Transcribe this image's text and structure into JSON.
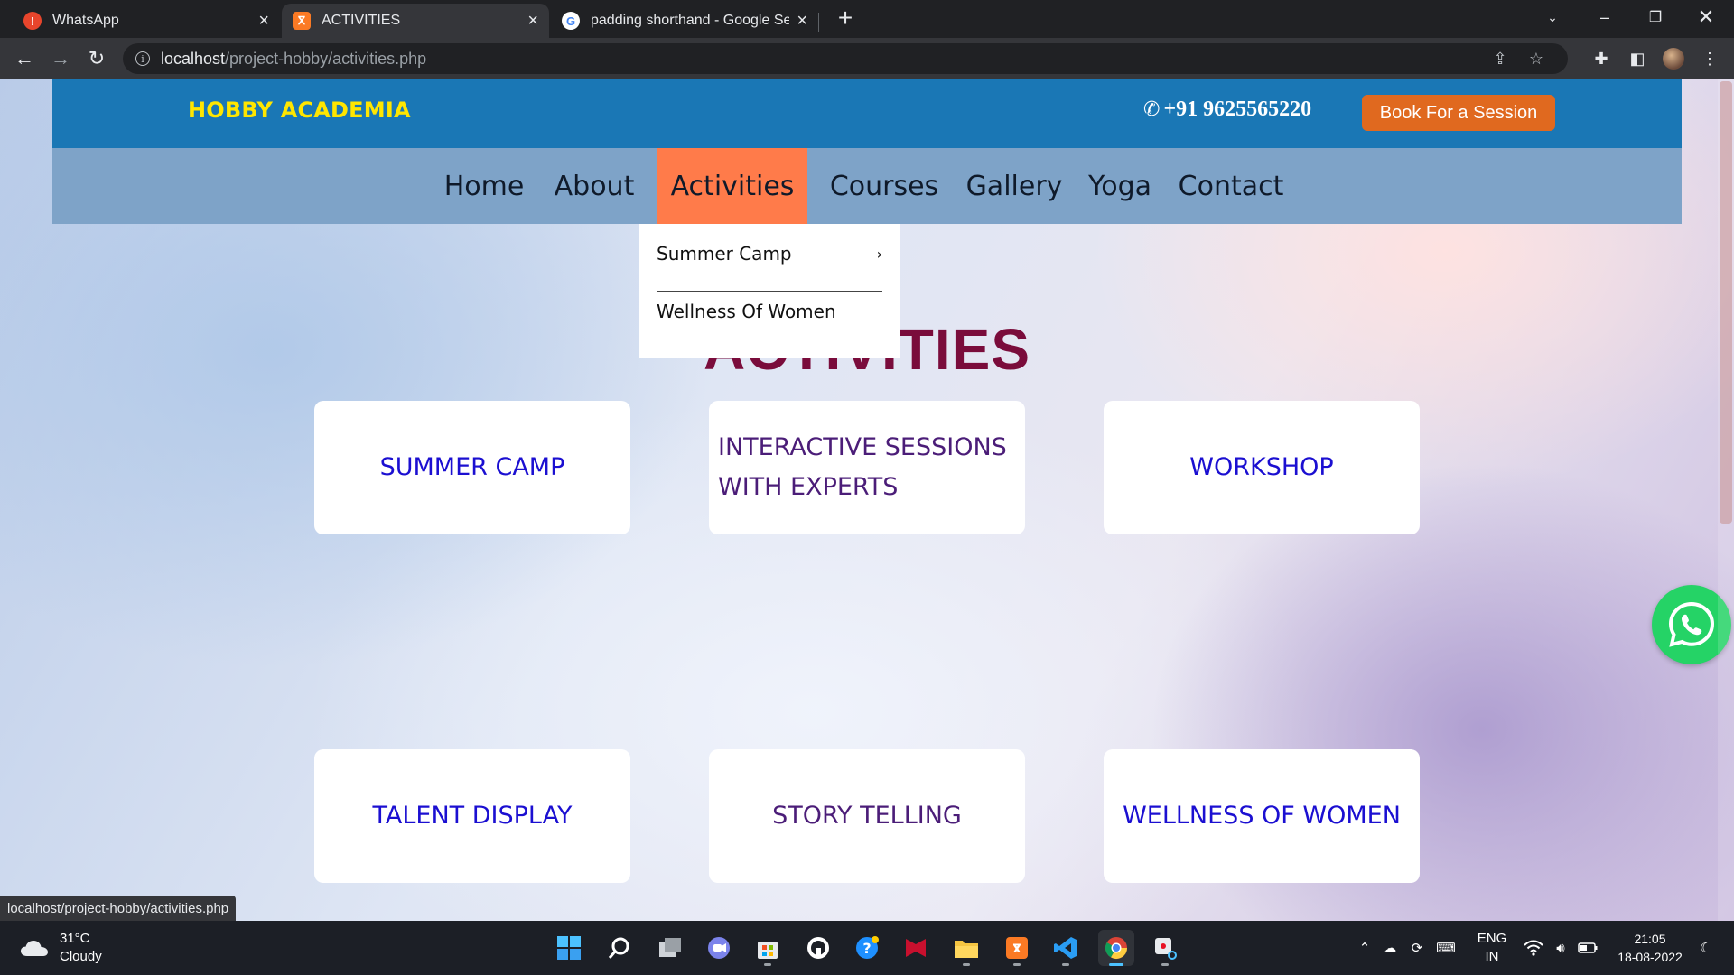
{
  "browser": {
    "tabs": [
      {
        "title": "WhatsApp",
        "favicon": "whatsapp-alert-icon",
        "active": false
      },
      {
        "title": "ACTIVITIES",
        "favicon": "xampp-icon",
        "active": true
      },
      {
        "title": "padding shorthand - Google Sea",
        "favicon": "google-icon",
        "active": false
      }
    ],
    "url": {
      "host": "localhost",
      "path": "/project-hobby/activities.php"
    },
    "status_url": "localhost/project-hobby/activities.php"
  },
  "site": {
    "logo": "HOBBY ACADEMIA",
    "phone": "+91 9625565220",
    "cta": "Book For a Session",
    "nav": [
      "Home",
      "About",
      "Activities",
      "Courses",
      "Gallery",
      "Yoga",
      "Contact"
    ],
    "active_nav": "Activities",
    "dropdown": [
      "Summer Camp",
      "Wellness Of Women"
    ],
    "heading": "ACTIVITIES",
    "cards": [
      "SUMMER CAMP",
      "INTERACTIVE SESSIONS WITH EXPERTS",
      "WORKSHOP",
      "TALENT DISPLAY",
      "STORY TELLING",
      "WELLNESS OF WOMEN"
    ],
    "colors": {
      "header": "#1a77b5",
      "nav": "#7ea3c8",
      "nav_active": "#ff7b4a",
      "logo": "#ffe600",
      "cta": "#e0691f",
      "heading": "#7a0c3b",
      "card_text_blue": "#1b0fd1",
      "card_text_purple": "#4b1d78"
    }
  },
  "taskbar": {
    "weather": {
      "temp": "31°C",
      "condition": "Cloudy"
    },
    "language": {
      "lang": "ENG",
      "region": "IN"
    },
    "clock": {
      "time": "21:05",
      "date": "18-08-2022"
    }
  }
}
